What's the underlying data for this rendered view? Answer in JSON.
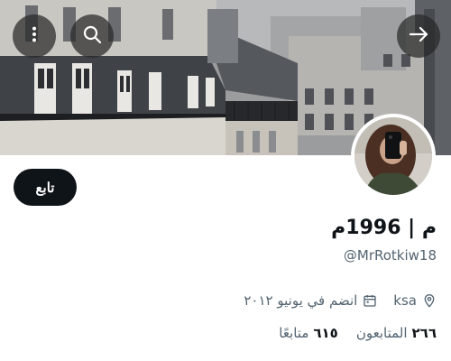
{
  "profile": {
    "display_name": "م | 1996م",
    "handle": "@MrRotkiw18",
    "location": "ksa",
    "joined": "انضم في يونيو ٢٠١٢"
  },
  "stats": {
    "followers_count": "٢٦٦",
    "followers_label": "المتابعون",
    "following_count": "٦١٥",
    "following_label": "متابعًا"
  },
  "buttons": {
    "follow_label": "تابع"
  },
  "icons": {
    "menu": "more-vertical-icon",
    "search": "search-icon",
    "back": "arrow-right-icon",
    "location": "location-pin-icon",
    "calendar": "calendar-icon"
  },
  "colors": {
    "primary_text": "#0f1419",
    "secondary_text": "#536471",
    "button_bg": "#0f1419",
    "button_text": "#ffffff"
  }
}
